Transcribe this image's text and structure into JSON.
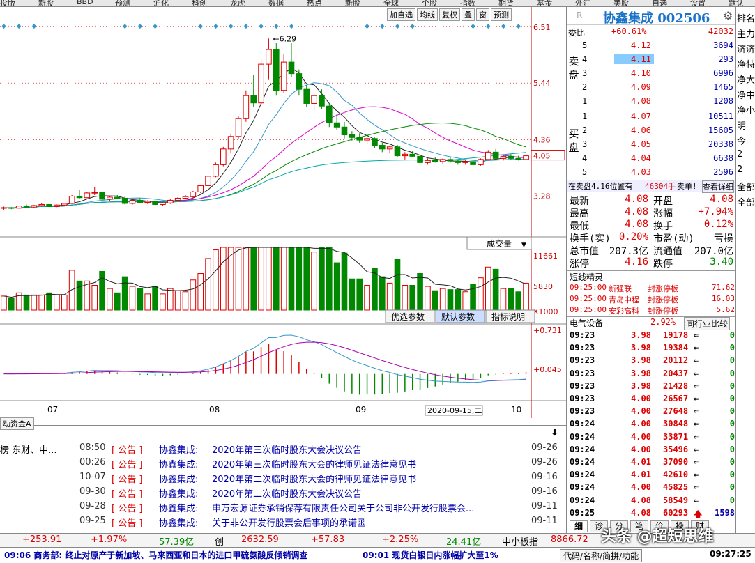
{
  "top_menu": [
    "投版",
    "新股",
    "BBD",
    "预测",
    "沪化",
    "科创",
    "龙虎",
    "数据",
    "热点",
    "新股",
    "全球",
    "个股",
    "指数",
    "期货",
    "基金",
    "外汇",
    "美股",
    "自选",
    "设置",
    "默认"
  ],
  "chart_tools": [
    "加自选",
    "均线",
    "复权",
    "叠",
    "窗",
    "预测"
  ],
  "stock": {
    "name": "协鑫集成",
    "code": "002506",
    "badge": "R"
  },
  "price_axis": {
    "labels": [
      "6.51",
      "5.44",
      "4.36",
      "4.05",
      "3.28"
    ],
    "peak_label": "6.29"
  },
  "volume_panel": {
    "label": "成交量",
    "axis": [
      "11661",
      "5830",
      "X1000"
    ],
    "tabs": [
      "优选参数",
      "默认参数",
      "指标说明"
    ]
  },
  "macd_panel": {
    "axis": [
      "+0.731",
      "+0.045"
    ]
  },
  "date_axis": {
    "labels": [
      "07",
      "08",
      "09",
      "10"
    ],
    "current": "2020-09-15,二"
  },
  "bottom_tab": "动资金A",
  "order_book": {
    "webi_label": "委比",
    "webi_value": "+60.61%",
    "webi_diff": "42032",
    "sell_label": "卖盘",
    "buy_label": "买盘",
    "sells": [
      {
        "lvl": "5",
        "price": "4.12",
        "vol": "3694"
      },
      {
        "lvl": "4",
        "price": "4.11",
        "vol": "293"
      },
      {
        "lvl": "3",
        "price": "4.10",
        "vol": "6996"
      },
      {
        "lvl": "2",
        "price": "4.09",
        "vol": "1465"
      },
      {
        "lvl": "1",
        "price": "4.08",
        "vol": "1208"
      }
    ],
    "buys": [
      {
        "lvl": "1",
        "price": "4.07",
        "vol": "10511"
      },
      {
        "lvl": "2",
        "price": "4.06",
        "vol": "15605"
      },
      {
        "lvl": "3",
        "price": "4.05",
        "vol": "20338"
      },
      {
        "lvl": "4",
        "price": "4.04",
        "vol": "6638"
      },
      {
        "lvl": "5",
        "price": "4.03",
        "vol": "2596"
      }
    ]
  },
  "alert": {
    "text": "在卖盘4.16位置有",
    "num": "46304手",
    "action": "卖单!",
    "link": "查看详细"
  },
  "quote": [
    {
      "l": "最新",
      "v": "4.08",
      "l2": "开盘",
      "v2": "4.08"
    },
    {
      "l": "最高",
      "v": "4.08",
      "l2": "涨幅",
      "v2": "+7.94%"
    },
    {
      "l": "最低",
      "v": "4.08",
      "l2": "换手",
      "v2": "0.12%"
    },
    {
      "l": "换手(实)",
      "v": "0.20%",
      "l2": "市盈(动)",
      "v2": "亏损"
    },
    {
      "l": "总市值",
      "v": "207.3亿",
      "l2": "流通值",
      "v2": "207.0亿"
    },
    {
      "l": "涨停",
      "v": "4.16",
      "l2": "跌停",
      "v2": "3.40"
    }
  ],
  "elves": {
    "title": "短线精灵",
    "rows": [
      {
        "t": "09:25:00",
        "name": "新强联",
        "ev": "封涨停板",
        "val": "71.62"
      },
      {
        "t": "09:25:00",
        "name": "青岛中程",
        "ev": "封涨停板",
        "val": "16.03"
      },
      {
        "t": "09:25:00",
        "name": "安彩高科",
        "ev": "封涨停板",
        "val": "5.62"
      }
    ]
  },
  "sector": {
    "name": "电气设备",
    "change": "2.92%",
    "button": "同行业比较"
  },
  "ticks": [
    {
      "t": "09:23",
      "p": "3.98",
      "v": "19178",
      "d": "0"
    },
    {
      "t": "09:23",
      "p": "3.98",
      "v": "19384",
      "d": "0"
    },
    {
      "t": "09:23",
      "p": "3.98",
      "v": "20112",
      "d": "0"
    },
    {
      "t": "09:23",
      "p": "3.98",
      "v": "20437",
      "d": "0"
    },
    {
      "t": "09:23",
      "p": "3.98",
      "v": "21428",
      "d": "0"
    },
    {
      "t": "09:23",
      "p": "4.00",
      "v": "26567",
      "d": "0"
    },
    {
      "t": "09:23",
      "p": "4.00",
      "v": "27648",
      "d": "0"
    },
    {
      "t": "09:24",
      "p": "4.00",
      "v": "30848",
      "d": "0"
    },
    {
      "t": "09:24",
      "p": "4.00",
      "v": "33871",
      "d": "0"
    },
    {
      "t": "09:24",
      "p": "4.00",
      "v": "35496",
      "d": "0"
    },
    {
      "t": "09:24",
      "p": "4.01",
      "v": "37090",
      "d": "0"
    },
    {
      "t": "09:24",
      "p": "4.01",
      "v": "42610",
      "d": "0"
    },
    {
      "t": "09:24",
      "p": "4.00",
      "v": "45825",
      "d": "0"
    },
    {
      "t": "09:24",
      "p": "4.08",
      "v": "58549",
      "d": "0"
    },
    {
      "t": "09:25",
      "p": "4.08",
      "v": "60293",
      "d": "1598"
    }
  ],
  "right_tabs": [
    "细",
    "诊",
    "分",
    "笔",
    "价",
    "操",
    "财"
  ],
  "far_right": [
    "排名",
    "主力",
    "济济",
    "净特",
    "净大",
    "净中",
    "净小",
    "明",
    "今",
    "2",
    "2",
    "全部",
    "全部"
  ],
  "news": [
    {
      "time": "08:50",
      "tag": "公告",
      "src": "协鑫集成:",
      "title": "2020年第三次临时股东大会决议公告",
      "date": "09-26"
    },
    {
      "time": "00:26",
      "tag": "公告",
      "src": "协鑫集成:",
      "title": "2020年第三次临时股东大会的律师见证法律意见书",
      "date": "09-26"
    },
    {
      "time": "10-07",
      "tag": "公告",
      "src": "协鑫集成:",
      "title": "2020年第二次临时股东大会的律师见证法律意见书",
      "date": "09-16"
    },
    {
      "time": "09-30",
      "tag": "公告",
      "src": "协鑫集成:",
      "title": "2020年第二次临时股东大会决议公告",
      "date": "09-16"
    },
    {
      "time": "09-28",
      "tag": "公告",
      "src": "协鑫集成:",
      "title": "申万宏源证券承销保荐有限责任公司关于公司非公开发行股票会...",
      "date": "09-11"
    },
    {
      "time": "09-25",
      "tag": "公告",
      "src": "协鑫集成:",
      "title": "关于非公开发行股票会后事项的承诺函",
      "date": "09-11"
    }
  ],
  "news_left": [
    "榜 东财、中...",
    ""
  ],
  "status": [
    {
      "v": "+253.91",
      "c": "#d00"
    },
    {
      "v": "+1.97%",
      "c": "#d00"
    },
    {
      "v": "57.39亿",
      "c": "#080"
    },
    {
      "v": "创",
      "c": "#000"
    },
    {
      "v": "2632.59",
      "c": "#d00"
    },
    {
      "v": "+57.83",
      "c": "#d00"
    },
    {
      "v": "+2.25%",
      "c": "#d00"
    },
    {
      "v": "24.41亿",
      "c": "#080"
    },
    {
      "v": "中小板指",
      "c": "#000"
    },
    {
      "v": "8866.72",
      "c": "#d00"
    }
  ],
  "watermark": "头条 @超短思维",
  "tickers": [
    {
      "t": "09:06 商务部:  终止对原产于新加坡、马来西亚和日本的进口甲硫氨酸反倾销调查"
    },
    {
      "t": "09:01 现货白银日内涨幅扩大至1%"
    }
  ],
  "footer_right": {
    "label": "代码/名称/简拼/功能",
    "time": "09:27:25"
  },
  "colors": {
    "up": "#d00",
    "down": "#080",
    "link": "#1a73c8"
  },
  "chart_data": {
    "type": "candlestick",
    "price_ylim": [
      2.9,
      6.6
    ],
    "candles": [
      [
        3.05,
        3.08,
        3.02,
        3.06
      ],
      [
        3.06,
        3.07,
        3.03,
        3.05
      ],
      [
        3.05,
        3.1,
        3.04,
        3.09
      ],
      [
        3.09,
        3.12,
        3.06,
        3.07
      ],
      [
        3.07,
        3.11,
        3.06,
        3.1
      ],
      [
        3.1,
        3.14,
        3.08,
        3.12
      ],
      [
        3.12,
        3.13,
        3.07,
        3.08
      ],
      [
        3.08,
        3.12,
        3.07,
        3.11
      ],
      [
        3.11,
        3.15,
        3.1,
        3.14
      ],
      [
        3.14,
        3.3,
        3.13,
        3.28
      ],
      [
        3.28,
        3.4,
        3.22,
        3.25
      ],
      [
        3.25,
        3.36,
        3.24,
        3.34
      ],
      [
        3.34,
        3.46,
        3.3,
        3.35
      ],
      [
        3.35,
        3.37,
        3.2,
        3.22
      ],
      [
        3.22,
        3.28,
        3.18,
        3.26
      ],
      [
        3.26,
        3.3,
        3.22,
        3.24
      ],
      [
        3.24,
        3.27,
        3.12,
        3.14
      ],
      [
        3.14,
        3.22,
        3.12,
        3.2
      ],
      [
        3.2,
        3.24,
        3.14,
        3.16
      ],
      [
        3.16,
        3.2,
        3.13,
        3.18
      ],
      [
        3.18,
        3.2,
        3.1,
        3.12
      ],
      [
        3.12,
        3.16,
        3.1,
        3.15
      ],
      [
        3.15,
        3.22,
        3.13,
        3.2
      ],
      [
        3.2,
        3.26,
        3.18,
        3.24
      ],
      [
        3.24,
        3.3,
        3.22,
        3.27
      ],
      [
        3.27,
        3.38,
        3.25,
        3.36
      ],
      [
        3.36,
        3.5,
        3.34,
        3.48
      ],
      [
        3.48,
        3.68,
        3.44,
        3.66
      ],
      [
        3.66,
        3.92,
        3.64,
        3.88
      ],
      [
        3.88,
        4.22,
        3.85,
        4.18
      ],
      [
        4.18,
        4.46,
        4.1,
        4.42
      ],
      [
        4.42,
        4.8,
        4.38,
        4.76
      ],
      [
        4.76,
        5.3,
        4.7,
        5.2
      ],
      [
        5.2,
        5.6,
        4.98,
        5.06
      ],
      [
        5.06,
        5.9,
        5.02,
        5.8
      ],
      [
        5.8,
        6.29,
        5.5,
        6.08
      ],
      [
        6.08,
        6.2,
        5.2,
        5.3
      ],
      [
        5.3,
        6.0,
        5.25,
        5.84
      ],
      [
        5.84,
        6.2,
        5.55,
        5.62
      ],
      [
        5.62,
        5.7,
        5.2,
        5.32
      ],
      [
        5.32,
        5.4,
        4.98,
        5.05
      ],
      [
        5.05,
        5.25,
        4.92,
        5.2
      ],
      [
        5.2,
        5.32,
        4.95,
        5.0
      ],
      [
        5.0,
        5.05,
        4.6,
        4.68
      ],
      [
        4.68,
        4.85,
        4.55,
        4.6
      ],
      [
        4.6,
        4.7,
        4.38,
        4.45
      ],
      [
        4.45,
        4.52,
        4.34,
        4.4
      ],
      [
        4.4,
        4.48,
        4.3,
        4.35
      ],
      [
        4.35,
        4.42,
        4.28,
        4.38
      ],
      [
        4.38,
        4.4,
        4.2,
        4.25
      ],
      [
        4.25,
        4.3,
        4.12,
        4.18
      ],
      [
        4.18,
        4.25,
        4.1,
        4.22
      ],
      [
        4.22,
        4.26,
        4.02,
        4.05
      ],
      [
        4.05,
        4.12,
        3.98,
        4.08
      ],
      [
        4.08,
        4.15,
        4.02,
        4.04
      ],
      [
        4.04,
        4.06,
        3.9,
        3.92
      ],
      [
        3.92,
        4.0,
        3.88,
        3.96
      ],
      [
        3.96,
        4.02,
        3.92,
        3.94
      ],
      [
        3.94,
        4.0,
        3.9,
        3.98
      ],
      [
        3.98,
        4.02,
        3.92,
        3.95
      ],
      [
        3.95,
        3.98,
        3.88,
        3.92
      ],
      [
        3.92,
        3.97,
        3.88,
        3.94
      ],
      [
        3.94,
        3.98,
        3.86,
        3.88
      ],
      [
        3.88,
        4.0,
        3.86,
        3.98
      ],
      [
        3.98,
        4.16,
        3.96,
        4.12
      ],
      [
        4.12,
        4.18,
        3.98,
        4.0
      ],
      [
        4.0,
        4.06,
        3.96,
        4.04
      ],
      [
        4.04,
        4.08,
        3.98,
        4.0
      ],
      [
        4.0,
        4.05,
        3.96,
        3.98
      ],
      [
        3.98,
        4.08,
        3.96,
        4.05
      ]
    ],
    "volume_ylim": [
      0,
      11661
    ],
    "macd_ylim": [
      -0.4,
      0.8
    ]
  }
}
